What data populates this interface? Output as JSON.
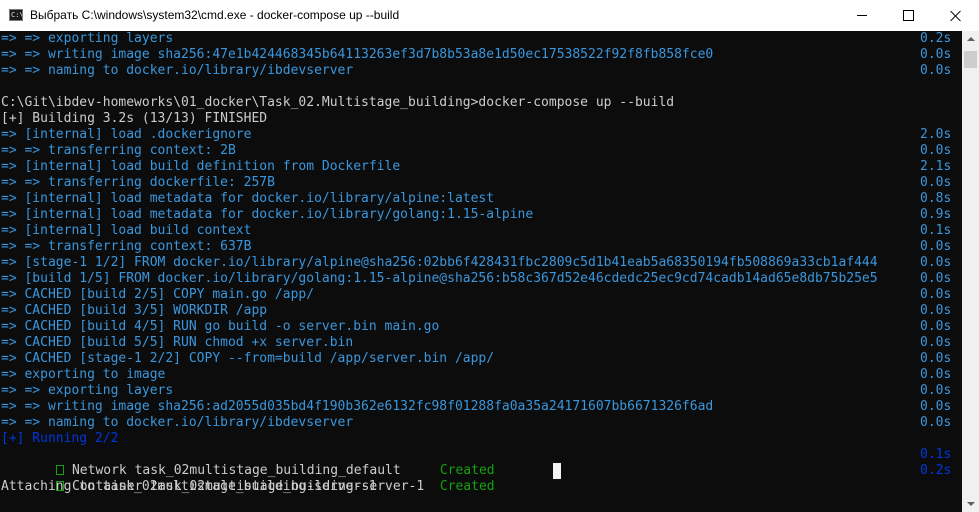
{
  "window": {
    "title": "Выбрать C:\\windows\\system32\\cmd.exe - docker-compose  up --build",
    "icon": "cmd-icon",
    "icon_glyph": "C:\\"
  },
  "colors": {
    "background": "#0c0c0c",
    "text": "#cccccc",
    "blue": "#3a96dd",
    "dark_blue": "#0037da",
    "green": "#13a10e"
  },
  "console": {
    "lines": [
      {
        "text": "=> => exporting layers",
        "time": "0.2s",
        "color": "blue"
      },
      {
        "text": "=> => writing image sha256:47e1b424468345b64113263ef3d7b8b53a8e1d50ec17538522f92f8fb858fce0",
        "time": "0.0s",
        "color": "blue"
      },
      {
        "text": "=> => naming to docker.io/library/ibdevserver",
        "time": "0.0s",
        "color": "blue"
      },
      {
        "text": "",
        "time": "",
        "color": "white"
      },
      {
        "text": "C:\\Git\\ibdev-homeworks\\01_docker\\Task_02.Multistage_building>docker-compose up --build",
        "time": "",
        "color": "white"
      },
      {
        "text": "[+] Building 3.2s (13/13) FINISHED",
        "time": "",
        "color": "white"
      },
      {
        "text": "=> [internal] load .dockerignore",
        "time": "2.0s",
        "color": "blue"
      },
      {
        "text": "=> => transferring context: 2B",
        "time": "0.0s",
        "color": "blue"
      },
      {
        "text": "=> [internal] load build definition from Dockerfile",
        "time": "2.1s",
        "color": "blue"
      },
      {
        "text": "=> => transferring dockerfile: 257B",
        "time": "0.0s",
        "color": "blue"
      },
      {
        "text": "=> [internal] load metadata for docker.io/library/alpine:latest",
        "time": "0.8s",
        "color": "blue"
      },
      {
        "text": "=> [internal] load metadata for docker.io/library/golang:1.15-alpine",
        "time": "0.9s",
        "color": "blue"
      },
      {
        "text": "=> [internal] load build context",
        "time": "0.1s",
        "color": "blue"
      },
      {
        "text": "=> => transferring context: 637B",
        "time": "0.0s",
        "color": "blue"
      },
      {
        "text": "=> [stage-1 1/2] FROM docker.io/library/alpine@sha256:02bb6f428431fbc2809c5d1b41eab5a68350194fb508869a33cb1af444",
        "time": "0.0s",
        "color": "blue"
      },
      {
        "text": "=> [build 1/5] FROM docker.io/library/golang:1.15-alpine@sha256:b58c367d52e46cdedc25ec9cd74cadb14ad65e8db75b25e5",
        "time": "0.0s",
        "color": "blue"
      },
      {
        "text": "=> CACHED [build 2/5] COPY main.go /app/",
        "time": "0.0s",
        "color": "blue"
      },
      {
        "text": "=> CACHED [build 3/5] WORKDIR /app",
        "time": "0.0s",
        "color": "blue"
      },
      {
        "text": "=> CACHED [build 4/5] RUN go build -o server.bin main.go",
        "time": "0.0s",
        "color": "blue"
      },
      {
        "text": "=> CACHED [build 5/5] RUN chmod +x server.bin",
        "time": "0.0s",
        "color": "blue"
      },
      {
        "text": "=> CACHED [stage-1 2/2] COPY --from=build /app/server.bin /app/",
        "time": "0.0s",
        "color": "blue"
      },
      {
        "text": "=> exporting to image",
        "time": "0.0s",
        "color": "blue"
      },
      {
        "text": "=> => exporting layers",
        "time": "0.0s",
        "color": "blue"
      },
      {
        "text": "=> => writing image sha256:ad2055d035bd4f190b362e6132fc98f01288fa0a35a24171607bb6671326f6ad",
        "time": "0.0s",
        "color": "blue"
      },
      {
        "text": "=> => naming to docker.io/library/ibdevserver",
        "time": "0.0s",
        "color": "blue"
      },
      {
        "text": "[+] Running 2/2",
        "time": "",
        "color": "dark_blue"
      }
    ],
    "status_rows": [
      {
        "text": "Network task_02multistage_building_default     ",
        "status": "Created",
        "time": "0.1s"
      },
      {
        "text": "Container task_02multistage_building-server-1  ",
        "status": "Created",
        "time": "0.2s"
      }
    ],
    "final_line": "Attaching to task_02multistage_building-server-1"
  }
}
